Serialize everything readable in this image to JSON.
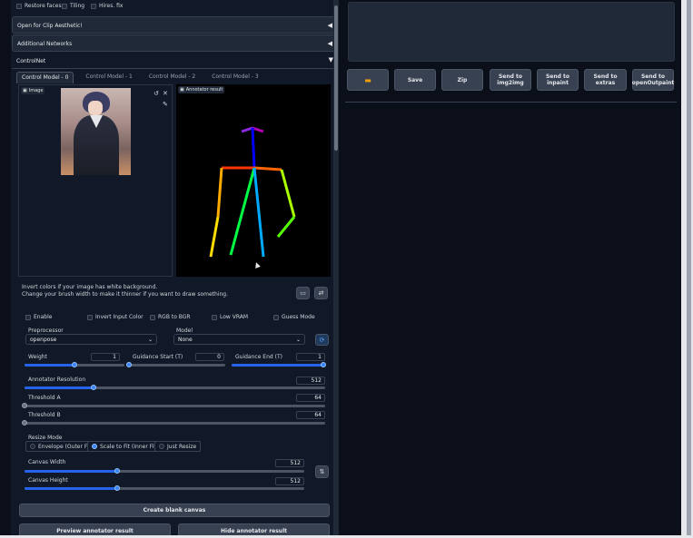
{
  "top_checkboxes": [
    "Restore faces",
    "Tiling",
    "Hires. fix"
  ],
  "accordions": {
    "clip_aesthetic": "Open for Clip Aesthetic!",
    "additional_networks": "Additional Networks",
    "controlnet": "ControlNet"
  },
  "tabs": [
    "Control Model - 0",
    "Control Model - 1",
    "Control Model - 2",
    "Control Model - 3"
  ],
  "image_label": "Image",
  "annotator_label": "Annotator result",
  "hint_line1": "Invert colors if your image has white background.",
  "hint_line2": "Change your brush width to make it thinner if you want to draw something.",
  "options": [
    "Enable",
    "Invert Input Color",
    "RGB to BGR",
    "Low VRAM",
    "Guess Mode"
  ],
  "preprocessor": {
    "label": "Preprocessor",
    "value": "openpose"
  },
  "model": {
    "label": "Model",
    "value": "None"
  },
  "weight": {
    "label": "Weight",
    "value": "1"
  },
  "guidance_start": {
    "label": "Guidance Start (T)",
    "value": "0"
  },
  "guidance_end": {
    "label": "Guidance End (T)",
    "value": "1"
  },
  "annotator_resolution": {
    "label": "Annotator Resolution",
    "value": "512"
  },
  "threshold_a": {
    "label": "Threshold A",
    "value": "64"
  },
  "threshold_b": {
    "label": "Threshold B",
    "value": "64"
  },
  "resize_mode": {
    "label": "Resize Mode",
    "options": [
      "Envelope (Outer Fit)",
      "Scale to Fit (Inner Fit)",
      "Just Resize"
    ],
    "selected": "Scale to Fit (Inner Fit)"
  },
  "canvas_width": {
    "label": "Canvas Width",
    "value": "512"
  },
  "canvas_height": {
    "label": "Canvas Height",
    "value": "512"
  },
  "create_canvas": "Create blank canvas",
  "preview_button": "Preview annotator result",
  "hide_button": "Hide annotator result",
  "action_buttons": {
    "save": "Save",
    "zip": "Zip",
    "img2img": [
      "Send to",
      "img2img"
    ],
    "inpaint": [
      "Send to",
      "inpaint"
    ],
    "extras": "Send to extras",
    "openoutpaint": [
      "Send to",
      "openOutpaint"
    ]
  },
  "slider_levels": {
    "weight": 0.5,
    "guidance_start": 0.0,
    "guidance_end": 1.0,
    "annotator_resolution": 0.23,
    "threshold_a": 0.0,
    "threshold_b": 0.0,
    "canvas_width": 0.33,
    "canvas_height": 0.33
  },
  "icons": {
    "folder": "folder-icon",
    "swap": "swap-icon",
    "edit": "edit-icon",
    "undo": "undo-icon",
    "close": "close-icon",
    "brush": "brush-icon",
    "camera": "camera-icon"
  },
  "colors": {
    "accent": "#3b82f6",
    "panel": "#1f2937",
    "background": "#0b0f19"
  }
}
